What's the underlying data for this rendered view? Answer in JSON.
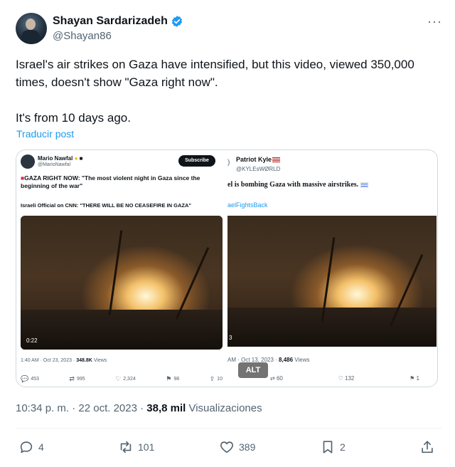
{
  "author": {
    "name": "Shayan Sardarizadeh",
    "handle": "@Shayan86",
    "more_icon": "more-dots-icon"
  },
  "tweet": {
    "line1": "Israel's air strikes on Gaza have intensified, but this video, viewed 350,000 times, doesn't show \"Gaza right now\".",
    "line2": "It's from 10 days ago.",
    "translate_link": "Traducir post"
  },
  "media": {
    "left": {
      "name": "Mario Nawfal",
      "handle": "@MarioNawfal",
      "subscribe": "Subscribe",
      "headline_prefix": "GAZA RIGHT NOW: ",
      "headline": "\"The most violent night in Gaza since the beginning of the war\"",
      "quote": "Israeli Official on CNN: \"THERE WILL BE NO CEASEFIRE IN GAZA\"",
      "video_time": "0:22",
      "date_text": "1:40 AM · Oct 23, 2023 · ",
      "views_value": "348.8K",
      "views_label": " Views",
      "replies": "453",
      "reposts": "995",
      "likes": "2,324",
      "bookmarks": "98",
      "share_count": "10"
    },
    "right": {
      "name": "Patriot Kyle",
      "handle": "@KYLEsWØRLD",
      "headline": "el is bombing Gaza with massive airstrikes.",
      "hashtag": "aelFightsBack",
      "video_time": "3",
      "date_text": "AM · Oct 13, 2023 · ",
      "views_value": "8,486",
      "views_label": " Views",
      "reposts": "60",
      "likes": "132",
      "bookmarks": "1"
    },
    "alt_badge": "ALT"
  },
  "meta": {
    "time": "10:34 p. m. · 22 oct. 2023 · ",
    "views_value": "38,8 mil",
    "views_label": " Visualizaciones"
  },
  "actions": {
    "replies": "4",
    "reposts": "101",
    "likes": "389",
    "bookmarks": "2"
  },
  "colors": {
    "link": "#1d9bf0",
    "verified": "#1d9bf0",
    "text_secondary": "#536471"
  }
}
